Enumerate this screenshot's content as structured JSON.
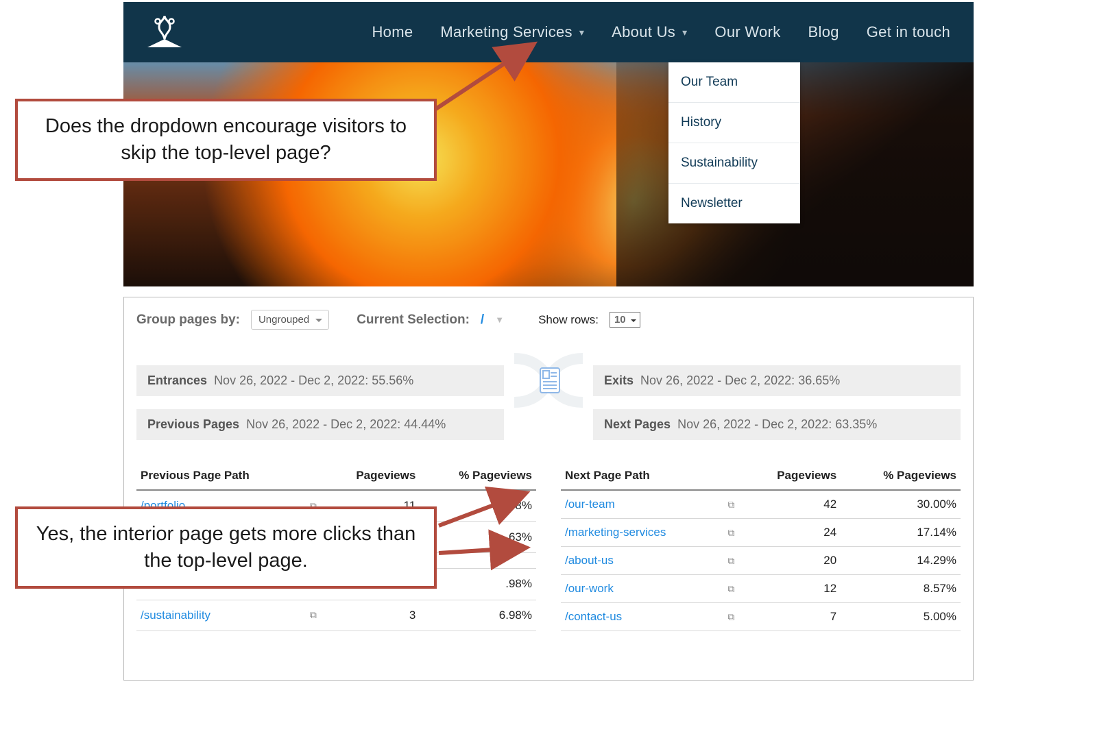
{
  "nav": {
    "items": [
      "Home",
      "Marketing Services",
      "About Us",
      "Our Work",
      "Blog",
      "Get in touch"
    ]
  },
  "dropdown": [
    "Our Team",
    "History",
    "Sustainability",
    "Newsletter"
  ],
  "callouts": {
    "c1": "Does the dropdown encourage visitors to skip the top-level page?",
    "c2": "Yes, the interior page gets more clicks than the top-level page."
  },
  "toolbar": {
    "group_label": "Group pages by:",
    "group_value": "Ungrouped",
    "selection_label": "Current Selection:",
    "selection_value": "/",
    "show_rows_label": "Show rows:",
    "show_rows_value": "10"
  },
  "flow": {
    "entrances_label": "Entrances",
    "entrances_value": "Nov 26, 2022 - Dec 2, 2022: 55.56%",
    "prev_label": "Previous Pages",
    "prev_value": "Nov 26, 2022 - Dec 2, 2022: 44.44%",
    "exits_label": "Exits",
    "exits_value": "Nov 26, 2022 - Dec 2, 2022: 36.65%",
    "next_label": "Next Pages",
    "next_value": "Nov 26, 2022 - Dec 2, 2022: 63.35%"
  },
  "table_headers": {
    "prev_path": "Previous Page Path",
    "next_path": "Next Page Path",
    "pv": "Pageviews",
    "pct": "% Pageviews"
  },
  "prev_rows": [
    {
      "path": "/portfolio",
      "pv": "11",
      "pct": "25.58%"
    },
    {
      "path": "",
      "pv": "",
      "pct": ".63%"
    },
    {
      "path": "",
      "pv": "",
      "pct": ""
    },
    {
      "path": "",
      "pv": "",
      "pct": ".98%"
    },
    {
      "path": "/sustainability",
      "pv": "3",
      "pct": "6.98%"
    }
  ],
  "next_rows": [
    {
      "path": "/our-team",
      "pv": "42",
      "pct": "30.00%"
    },
    {
      "path": "/marketing-services",
      "pv": "24",
      "pct": "17.14%"
    },
    {
      "path": "/about-us",
      "pv": "20",
      "pct": "14.29%"
    },
    {
      "path": "/our-work",
      "pv": "12",
      "pct": "8.57%"
    },
    {
      "path": "/contact-us",
      "pv": "7",
      "pct": "5.00%"
    }
  ]
}
